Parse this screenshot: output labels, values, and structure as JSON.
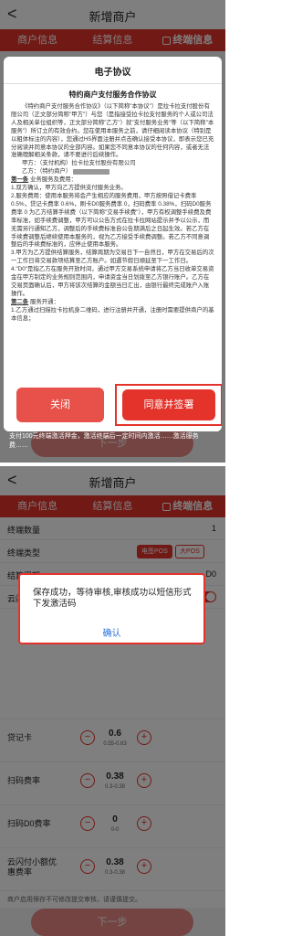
{
  "screen1": {
    "nav": {
      "title": "新增商户",
      "back": "<"
    },
    "tabs": [
      "商户信息",
      "结算信息",
      "终端信息"
    ],
    "modal": {
      "title": "电子协议",
      "subtitle": "特约商户支付服务合作协议",
      "paragraphs": [
        "《特约商户支付服务合作协议》（以下简称\"本协议\"）是拉卡拉支付股份有限公司（正文部分简称\"甲方\"）与您（是指接受拉卡拉支付服务的个人或公司法人及相关单位组织等，正文部分简称\"乙方\"）就\"支付服务业务\"等（以下简称\"本服务\"）所订立的有效合约。您在使用本服务之前，请仔细阅读本协议（特别是以粗体标注的内容），您通过H5界面注册并点击确认接受本协议，即表示您已充分阅读并同意本协议的全部内容。如果您不同意本协议的任何内容，或者无法准确理解相关条款，请不要进行后续操作。",
        "甲方：（支付机构）拉卡拉支付股份有限公司",
        "乙方：（特约商户）"
      ],
      "section1": "第一条",
      "section1_title": " 业务服务及费用：",
      "items": [
        "1.双方确认，甲方向乙方提供支付服务业务。",
        "2.服务费用：使用本服务将会产生相应的服务费用，甲方按照借记卡费率 0.5%，贷记卡费率 0.6%，刷卡D0服务费率 0，扫码费率 0.38%，扫码D0服务费率 0 为乙方结算手续费（以下简称\"交易手续费\"），甲方有权调整手续费及费率标准，如手续费调整，甲方可以公告方式在拉卡拉网站提示并予以公示，而无需另行通知乙方，调整后的手续费标准自公告期满后之日起生效。若乙方在手续费调整后继续使用本服务的，视为乙方接受手续费调整。若乙方不同意调整后的手续费标准的，应停止使用本服务。",
        "3.甲方为乙方提供结算服务，结算周期为交易日下一自然日，甲方在交易后的次一工作日将交易款项结算至乙方账户。如遇节假日顺延至下一工作日。",
        "4.\"D0\"是指乙方在服务开放时间，通过甲方交易系统申请将乙方当日收单交易资金在甲方制定的业务规则范围内，申请资金当日划拨至乙方银行账户。乙方在交易页面确认后，甲方将该次结算的金额当日汇出，由银行最终完成账户入账操作。"
      ],
      "section2": "第二条",
      "section2_title": " 服务开通：",
      "items2": [
        "1.乙方通过扫描拉卡拉机身二维码，进行注册并开通，注册时需要提供商户的基本信息；",
        "支付100元终端激活押金，激活终端后一定时间内激活……激活服务费……"
      ],
      "close_label": "关闭",
      "agree_label": "同意并签署"
    },
    "bottom_button": "下一步"
  },
  "screen2": {
    "nav": {
      "title": "新增商户",
      "back": "<"
    },
    "tabs": [
      "商户信息",
      "结算信息",
      "终端信息"
    ],
    "form": {
      "terminal_count_label": "终端数量",
      "terminal_count_value": "1",
      "terminal_type_label": "终端类型",
      "terminal_type_options": [
        "电签POS",
        "大POS"
      ],
      "settle_cycle_label": "结算周期",
      "settle_cycle_value": "D0",
      "quickpass_label": "云闪付小额优惠",
      "rates": [
        {
          "label": "贷记卡",
          "value": "0.6",
          "range": "0.55-0.63"
        },
        {
          "label": "扫码费率",
          "value": "0.38",
          "range": "0.3-0.38"
        },
        {
          "label": "扫码D0费率",
          "value": "0",
          "range": "0-0"
        },
        {
          "label": "云闪付小额优惠费率",
          "value": "0.38",
          "range": "0.3-0.38"
        }
      ],
      "note": "商户启用保存不可修改提交审核，请谨慎提交。"
    },
    "dialog": {
      "message": "保存成功，等待审核,审核成功以短信形式下发激活码",
      "ok_label": "确认"
    },
    "bottom_button": "下一步"
  }
}
